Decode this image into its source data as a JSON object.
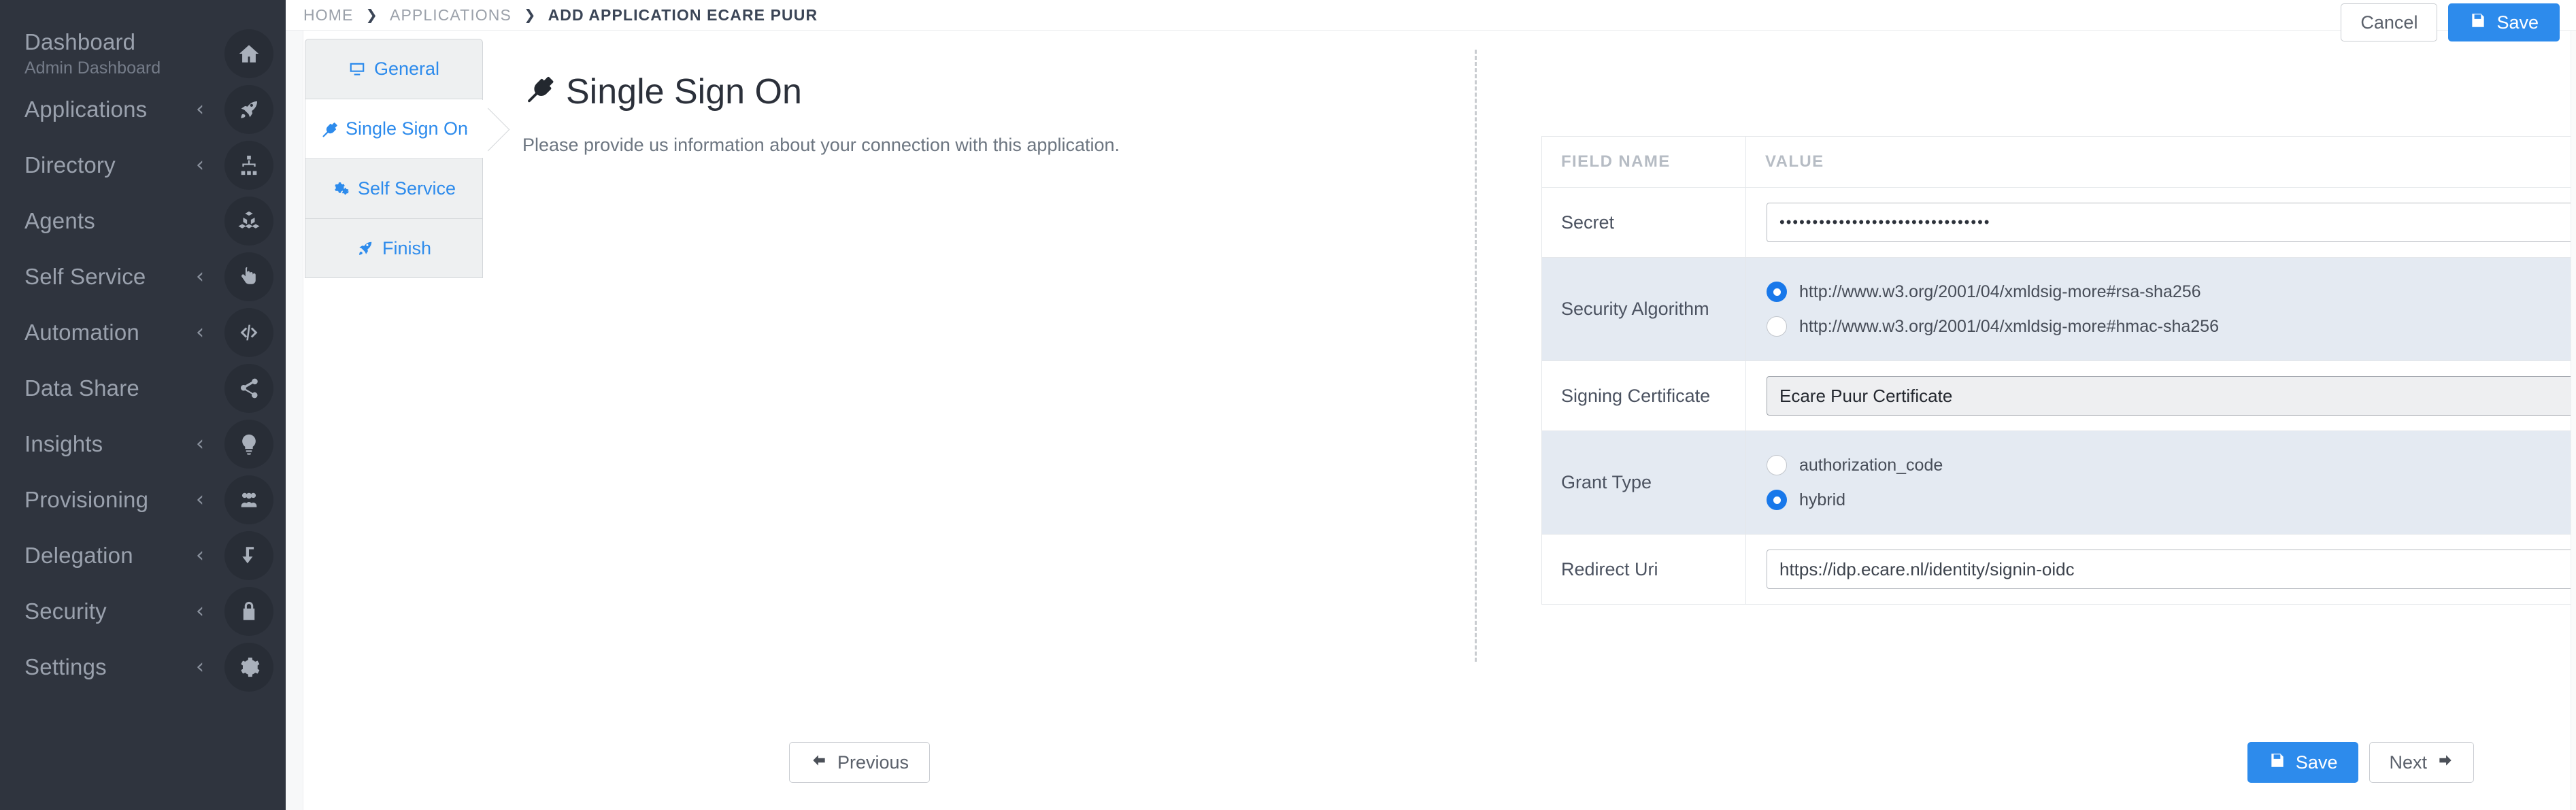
{
  "sidebar": {
    "items": [
      {
        "label": "Dashboard",
        "sublabel": "Admin Dashboard",
        "icon": "home-icon",
        "caret": ""
      },
      {
        "label": "Applications",
        "sublabel": "",
        "icon": "rocket-icon",
        "caret": "‹"
      },
      {
        "label": "Directory",
        "sublabel": "",
        "icon": "sitemap-icon",
        "caret": "‹"
      },
      {
        "label": "Agents",
        "sublabel": "",
        "icon": "cubes-icon",
        "caret": ""
      },
      {
        "label": "Self Service",
        "sublabel": "",
        "icon": "hand-pointer-icon",
        "caret": "‹"
      },
      {
        "label": "Automation",
        "sublabel": "",
        "icon": "code-icon",
        "caret": "‹"
      },
      {
        "label": "Data Share",
        "sublabel": "",
        "icon": "share-icon",
        "caret": ""
      },
      {
        "label": "Insights",
        "sublabel": "",
        "icon": "lightbulb-icon",
        "caret": "‹"
      },
      {
        "label": "Provisioning",
        "sublabel": "",
        "icon": "users-icon",
        "caret": "‹"
      },
      {
        "label": "Delegation",
        "sublabel": "",
        "icon": "level-down-icon",
        "caret": "‹"
      },
      {
        "label": "Security",
        "sublabel": "",
        "icon": "lock-icon",
        "caret": "‹"
      },
      {
        "label": "Settings",
        "sublabel": "",
        "icon": "gear-icon",
        "caret": "‹"
      }
    ]
  },
  "topbar": {
    "breadcrumb": [
      {
        "label": "HOME"
      },
      {
        "label": "APPLICATIONS"
      },
      {
        "label": "ADD APPLICATION ECARE PUUR"
      }
    ],
    "separator": "❯",
    "cancel_label": "Cancel",
    "save_label": "Save"
  },
  "steps": [
    {
      "label": "General",
      "icon": "monitor-icon",
      "active": false
    },
    {
      "label": "Single Sign On",
      "icon": "plug-icon",
      "active": true
    },
    {
      "label": "Self Service",
      "icon": "gears-icon",
      "active": false
    },
    {
      "label": "Finish",
      "icon": "rocket-icon",
      "active": false
    }
  ],
  "page": {
    "title": "Single Sign On",
    "title_icon": "plug-icon",
    "subtitle": "Please provide us information about your connection with this application."
  },
  "table": {
    "headers": {
      "field_name": "FIELD NAME",
      "value": "VALUE"
    },
    "rows": [
      {
        "name": "Secret",
        "type": "password",
        "value": "••••••••••••••••••••••••••••••••",
        "info": true,
        "zebra": false
      },
      {
        "name": "Security Algorithm",
        "type": "radio",
        "options": [
          {
            "label": "http://www.w3.org/2001/04/xmldsig-more#rsa-sha256",
            "selected": true
          },
          {
            "label": "http://www.w3.org/2001/04/xmldsig-more#hmac-sha256",
            "selected": false
          }
        ],
        "info": false,
        "zebra": true
      },
      {
        "name": "Signing Certificate",
        "type": "select",
        "value": "Ecare Puur Certificate",
        "info": false,
        "zebra": false
      },
      {
        "name": "Grant Type",
        "type": "radio",
        "options": [
          {
            "label": "authorization_code",
            "selected": false
          },
          {
            "label": "hybrid",
            "selected": true
          }
        ],
        "info": false,
        "zebra": true
      },
      {
        "name": "Redirect Uri",
        "type": "text",
        "value": "https://idp.ecare.nl/identity/signin-oidc",
        "info": true,
        "zebra": false
      }
    ]
  },
  "footer": {
    "previous_label": "Previous",
    "save_label": "Save",
    "next_label": "Next"
  },
  "colors": {
    "sidebar_bg": "#2f343e",
    "accent_blue": "#2d8bec",
    "radio_blue": "#1878ea",
    "zebra_row": "#e4eaf2",
    "info_blue": "#1d7fe0"
  }
}
